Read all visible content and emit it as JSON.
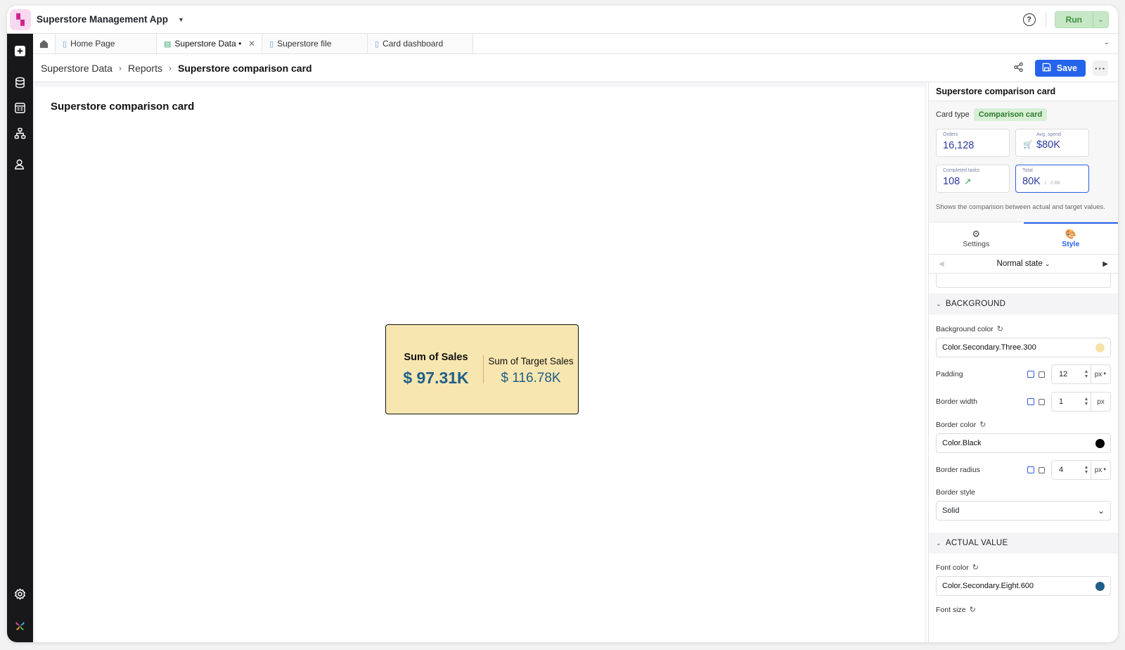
{
  "app": {
    "title": "Superstore Management App",
    "run_label": "Run"
  },
  "tabs": [
    {
      "label": "Home Page"
    },
    {
      "label": "Superstore Data •"
    },
    {
      "label": "Superstore file"
    },
    {
      "label": "Card dashboard"
    }
  ],
  "breadcrumb": {
    "root": "Superstore Data",
    "mid": "Reports",
    "current": "Superstore comparison card"
  },
  "actions": {
    "save_label": "Save"
  },
  "canvas": {
    "title": "Superstore comparison card",
    "card": {
      "actual_label": "Sum of Sales",
      "actual_value": "$ 97.31K",
      "target_label": "Sum of Target Sales",
      "target_value": "$ 116.78K",
      "background": "#f8e6b0",
      "value_color": "#1e5f89"
    }
  },
  "panel": {
    "title": "Superstore comparison card",
    "card_type_label": "Card type",
    "card_type_value": "Comparison card",
    "kpis": [
      {
        "label": "Orders",
        "value": "16,128"
      },
      {
        "label": "Avg. spend",
        "value": "$80K"
      },
      {
        "label": "Completed tasks",
        "value": "108"
      },
      {
        "label": "Total",
        "value": "80K",
        "sub": "2.6K"
      }
    ],
    "description": "Shows the comparison between actual and target values.",
    "tabs": {
      "settings": "Settings",
      "style": "Style"
    },
    "state": "Normal state",
    "background": {
      "heading": "BACKGROUND",
      "bg_color_label": "Background color",
      "bg_color_value": "Color.Secondary.Three.300",
      "bg_color_swatch": "#f7e3a9",
      "padding_label": "Padding",
      "padding_value": "12",
      "padding_unit": "px",
      "border_width_label": "Border width",
      "border_width_value": "1",
      "border_width_unit": "px",
      "border_color_label": "Border color",
      "border_color_value": "Color.Black",
      "border_color_swatch": "#000000",
      "border_radius_label": "Border radius",
      "border_radius_value": "4",
      "border_radius_unit": "px",
      "border_style_label": "Border style",
      "border_style_value": "Solid"
    },
    "actual_value": {
      "heading": "ACTUAL VALUE",
      "font_color_label": "Font color",
      "font_color_value": "Color.Secondary.Eight.600",
      "font_color_swatch": "#1f5f8b",
      "font_size_label": "Font size"
    }
  }
}
